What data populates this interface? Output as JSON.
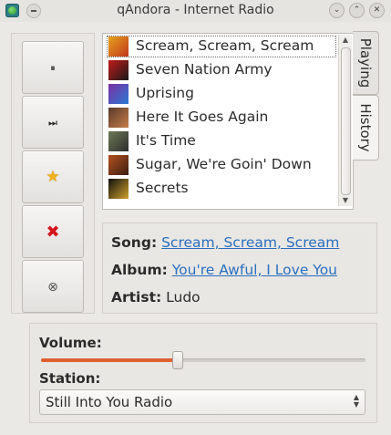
{
  "window": {
    "title": "qAndora - Internet Radio",
    "buttons": {
      "minimize": "⌄",
      "maximize": "⌃",
      "close": "✕"
    }
  },
  "controls": [
    {
      "name": "pause-button",
      "icon": "pause-icon",
      "glyph": "⏸"
    },
    {
      "name": "skip-button",
      "icon": "skip-next-icon",
      "glyph": "⏭"
    },
    {
      "name": "love-button",
      "icon": "star-icon",
      "glyph": "★"
    },
    {
      "name": "ban-button",
      "icon": "red-x-icon",
      "glyph": "✖"
    },
    {
      "name": "tired-button",
      "icon": "tired-icon",
      "glyph": "⊗"
    }
  ],
  "playlist": {
    "tracks": [
      {
        "title": "Scream, Scream, Scream",
        "art": [
          "#e7a21a",
          "#c0381f"
        ]
      },
      {
        "title": "Seven Nation Army",
        "art": [
          "#c21b1b",
          "#1a1a1a"
        ]
      },
      {
        "title": "Uprising",
        "art": [
          "#7b2fa2",
          "#2a7ad1"
        ]
      },
      {
        "title": "Here It Goes Again",
        "art": [
          "#5a3a2a",
          "#c57d4a"
        ]
      },
      {
        "title": "It's Time",
        "art": [
          "#6d7a55",
          "#2d2d2d"
        ]
      },
      {
        "title": "Sugar, We're Goin' Down",
        "art": [
          "#b4501f",
          "#3b1e12"
        ]
      },
      {
        "title": "Secrets",
        "art": [
          "#0f0f0f",
          "#d0a12a"
        ]
      }
    ],
    "selected_index": 0
  },
  "tabs": [
    {
      "label": "Playing",
      "active": false
    },
    {
      "label": "History",
      "active": true
    }
  ],
  "info": {
    "song_label": "Song:",
    "song": "Scream, Scream, Scream",
    "album_label": "Album:",
    "album": "You're Awful, I Love You",
    "artist_label": "Artist:",
    "artist": "Ludo"
  },
  "volume": {
    "label": "Volume:",
    "level_percent": 42
  },
  "station": {
    "label": "Station:",
    "selected": "Still Into You Radio"
  },
  "colors": {
    "accent": "#e0602f",
    "link": "#2a6fbd"
  }
}
